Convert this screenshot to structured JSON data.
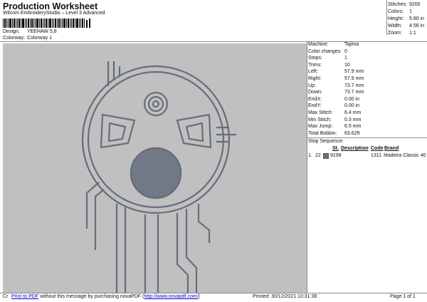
{
  "header": {
    "title": "Production Worksheet",
    "subtitle": "Wilcom EmbroideryStudio – Level 3 Advanced",
    "design_label": "Design:",
    "design_value": "YEEHAW 5,8",
    "colorway_label": "Colorway:",
    "colorway_value": "Colorway 1"
  },
  "top_stats": [
    {
      "label": "Stitches:",
      "value": "9200"
    },
    {
      "label": "Colors:",
      "value": "1"
    },
    {
      "label": "Height:",
      "value": "5.80 in"
    },
    {
      "label": "Width:",
      "value": "4.56 in"
    },
    {
      "label": "Zoom:",
      "value": "1:1"
    }
  ],
  "machine_info": [
    {
      "label": "Machine:",
      "value": "Tajima"
    },
    {
      "label": "Color changes:",
      "value": "0"
    },
    {
      "label": "Stops:",
      "value": "1"
    },
    {
      "label": "Trims:",
      "value": "10"
    },
    {
      "label": "Left:",
      "value": "57.9 mm"
    },
    {
      "label": "Right:",
      "value": "57.9 mm"
    },
    {
      "label": "Up:",
      "value": "73.7 mm"
    },
    {
      "label": "Down:",
      "value": "73.7 mm"
    },
    {
      "label": "EndX:",
      "value": "0.00 in"
    },
    {
      "label": "EndY:",
      "value": "0.00 in"
    },
    {
      "label": "Max Stitch:",
      "value": "6.4 mm"
    },
    {
      "label": "Min Stitch:",
      "value": "0.3 mm"
    },
    {
      "label": "Max Jump:",
      "value": "6.5 mm"
    },
    {
      "label": "Total Bobbin:",
      "value": "63.62ft"
    }
  ],
  "stop_sequence": {
    "label": "Stop Sequence:",
    "columns": [
      "St.",
      "Description",
      "Code",
      "Brand"
    ],
    "rows": [
      {
        "index": "1.",
        "stitches": "22",
        "description": "9198",
        "code": "1311",
        "brand": "Madeira Classic 40"
      }
    ]
  },
  "colors": {
    "thread": "#666e7c",
    "canvas": "#c0c0c0"
  },
  "footer": {
    "prefix": "Cr",
    "link_text": "Print to PDF",
    "message": " without this message by purchasing novaPDF (",
    "url_text": "http://www.novapdf.com/",
    "suffix": ")",
    "printed": "Printed: 30/12/2021 10:31:38",
    "page": "Page 1 of 1"
  }
}
